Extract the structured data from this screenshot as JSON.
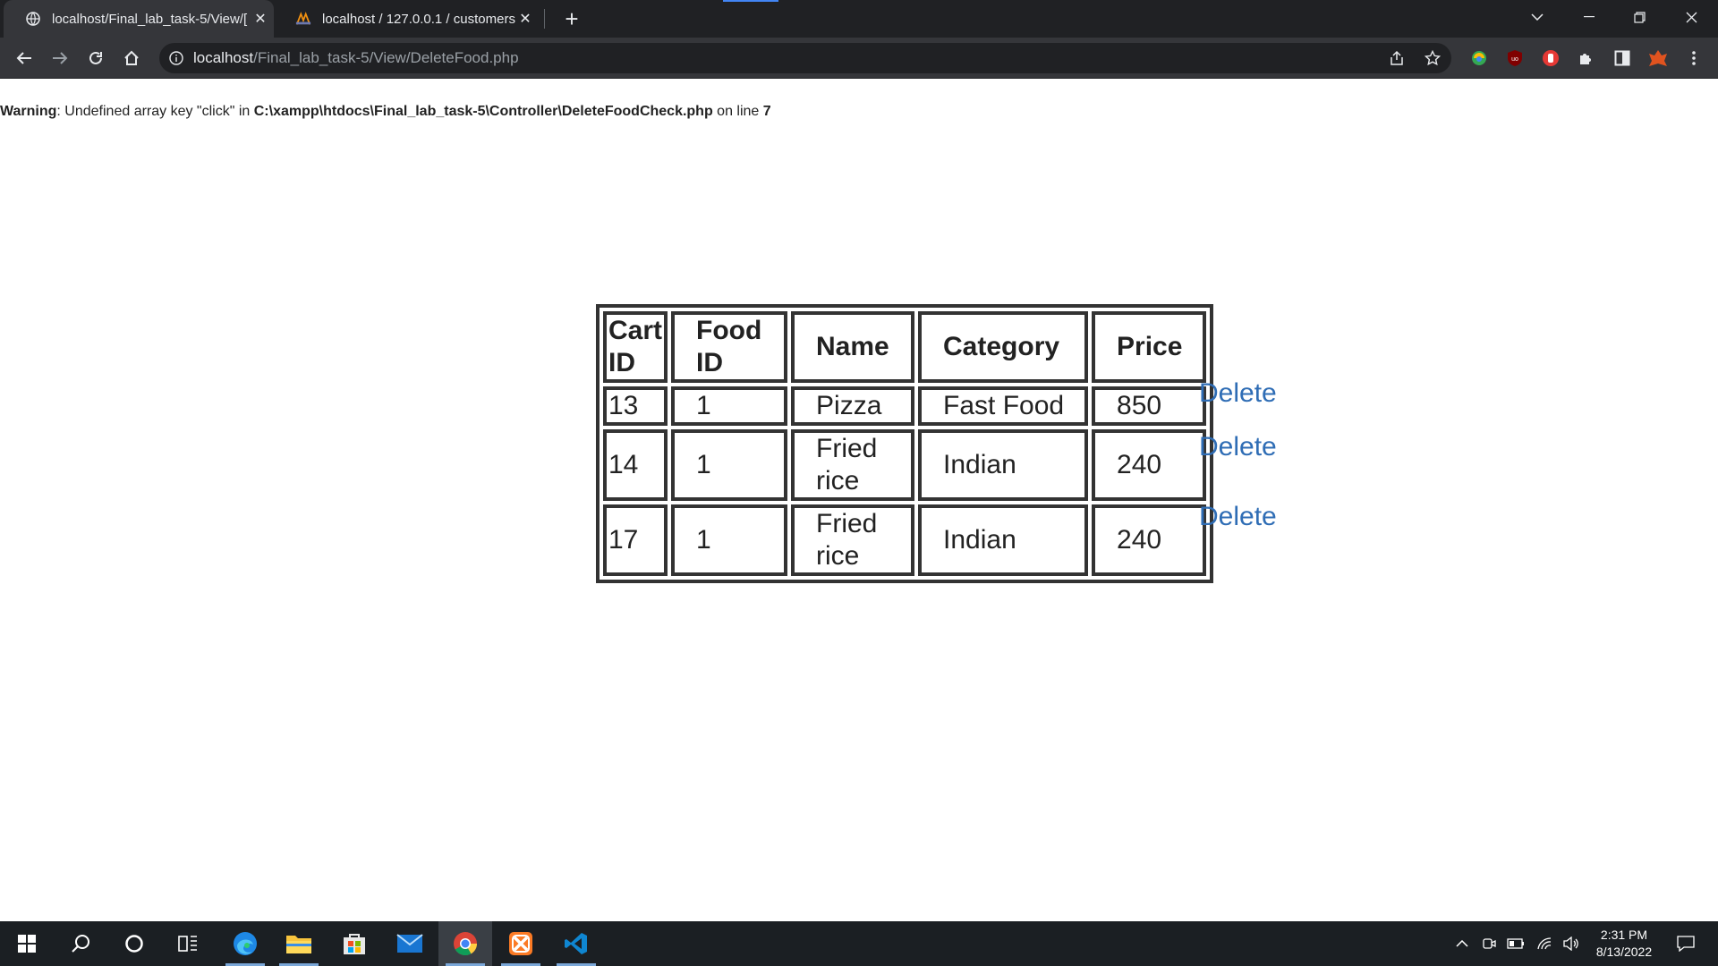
{
  "browser": {
    "tabs": [
      {
        "title": "localhost/Final_lab_task-5/View/[",
        "active": true
      },
      {
        "title": "localhost / 127.0.0.1 / customers",
        "active": false
      }
    ],
    "url": {
      "host": "localhost",
      "path": "/Final_lab_task-5/View/DeleteFood.php"
    }
  },
  "warning": {
    "label": "Warning",
    "message_1": ": Undefined array key \"click\" in ",
    "file": "C:\\xampp\\htdocs\\Final_lab_task-5\\Controller\\DeleteFoodCheck.php",
    "message_2": " on line ",
    "line": "7"
  },
  "table": {
    "headers": [
      {
        "line1": "Cart",
        "line2": "ID"
      },
      {
        "line1": "Food",
        "line2": "ID"
      },
      {
        "line1": "Name",
        "line2": ""
      },
      {
        "line1": "Category",
        "line2": ""
      },
      {
        "line1": "Price",
        "line2": ""
      }
    ],
    "rows": [
      {
        "cart_id": "13",
        "food_id": "1",
        "name_1": "Pizza",
        "name_2": "",
        "category": "Fast Food",
        "price": "850",
        "action": "Delete"
      },
      {
        "cart_id": "14",
        "food_id": "1",
        "name_1": "Fried",
        "name_2": "rice",
        "category": "Indian",
        "price": "240",
        "action": "Delete"
      },
      {
        "cart_id": "17",
        "food_id": "1",
        "name_1": "Fried",
        "name_2": "rice",
        "category": "Indian",
        "price": "240",
        "action": "Delete"
      }
    ]
  },
  "taskbar": {
    "time": "2:31 PM",
    "date": "8/13/2022"
  },
  "colors": {
    "link": "#2f6db5",
    "chrome_dark": "#202124",
    "chrome_toolbar": "#35363a"
  }
}
